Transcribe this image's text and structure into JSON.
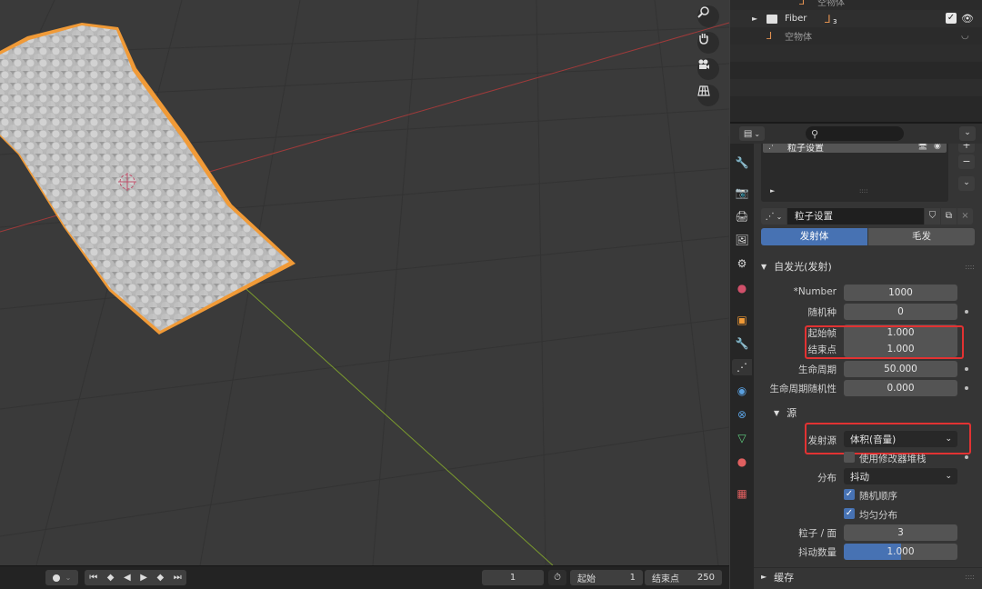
{
  "outliner": {
    "items": [
      {
        "label": "空物体"
      },
      {
        "label": "Fiber",
        "badge": "3"
      },
      {
        "label": "空物体"
      }
    ]
  },
  "properties": {
    "slot_name": "粒子设置",
    "datablock_name": "粒子设置",
    "tabs": {
      "emitter": "发射体",
      "hair": "毛发"
    },
    "emission": {
      "title": "自发光(发射)",
      "number_label": "*Number",
      "number": "1000",
      "seed_label": "随机种",
      "seed": "0",
      "frame_start_label": "起始帧",
      "frame_start": "1.000",
      "frame_end_label": "结束点",
      "frame_end": "1.000",
      "lifetime_label": "生命周期",
      "lifetime": "50.000",
      "lifetime_random_label": "生命周期随机性",
      "lifetime_random": "0.000"
    },
    "source": {
      "title": "源",
      "emit_from_label": "发射源",
      "emit_from": "体积(音量)",
      "modifier_stack_label": "使用修改器堆栈",
      "distribution_label": "分布",
      "distribution": "抖动",
      "random_order_label": "随机顺序",
      "even_distribution_label": "均匀分布",
      "particles_per_face_label": "粒子 / 面",
      "particles_per_face": "3",
      "jitter_amount_label": "抖动数量",
      "jitter_amount": "1.000",
      "jitter_fraction": 0.5
    },
    "cache": {
      "title": "缓存"
    }
  },
  "timeline": {
    "current_frame": "1",
    "start_label": "起始",
    "start": "1",
    "end_label": "结束点",
    "end": "250"
  },
  "colors": {
    "accent": "#4772b3",
    "highlight": "#e23232",
    "selection": "#f09a37"
  }
}
